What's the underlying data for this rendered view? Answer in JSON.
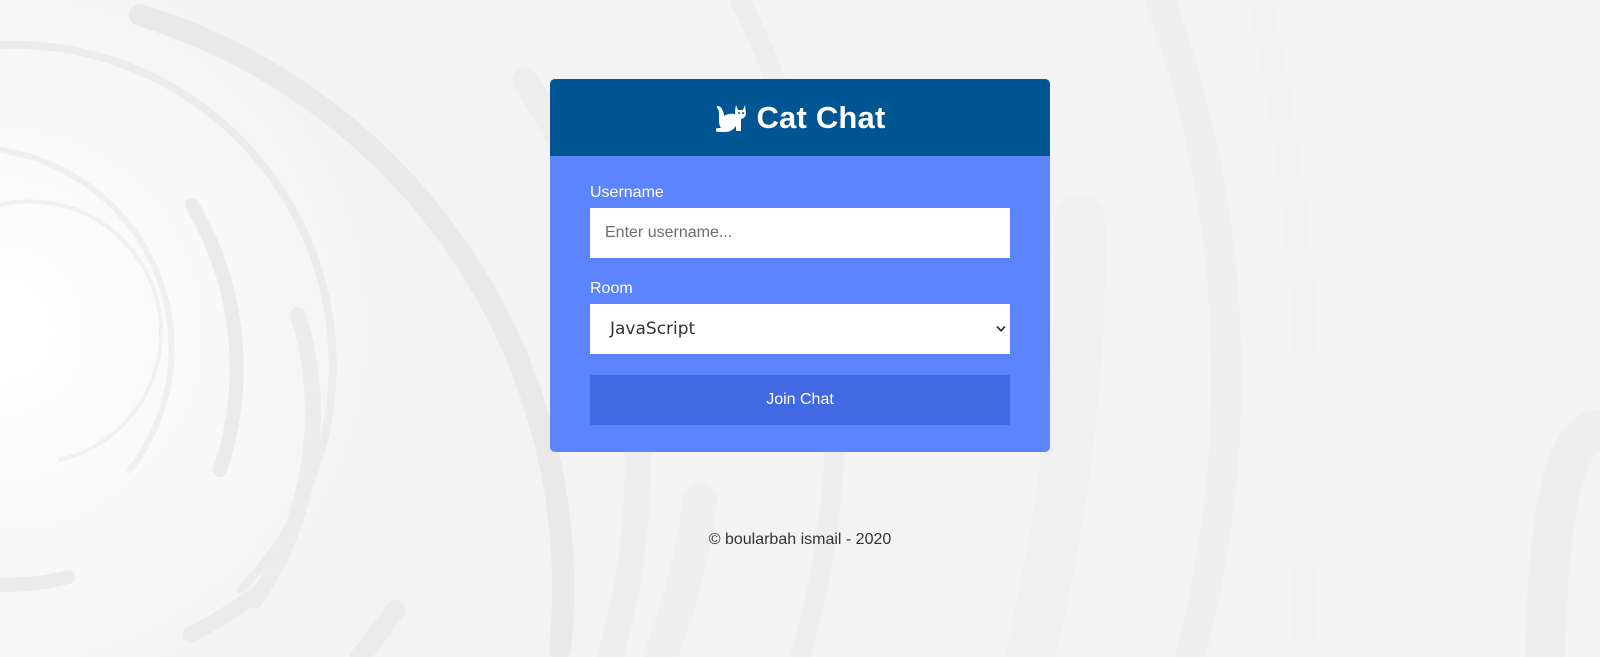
{
  "header": {
    "icon": "cat-icon",
    "title": "Cat Chat"
  },
  "form": {
    "username_label": "Username",
    "username_placeholder": "Enter username...",
    "username_value": "",
    "room_label": "Room",
    "room_selected": "JavaScript",
    "join_label": "Join Chat"
  },
  "footer": {
    "text": "© boularbah ismail - 2020"
  },
  "colors": {
    "header_bg": "#005692",
    "card_bg": "#5c84ff",
    "button_bg": "#4169e1",
    "page_bg": "#f3f3f3"
  }
}
